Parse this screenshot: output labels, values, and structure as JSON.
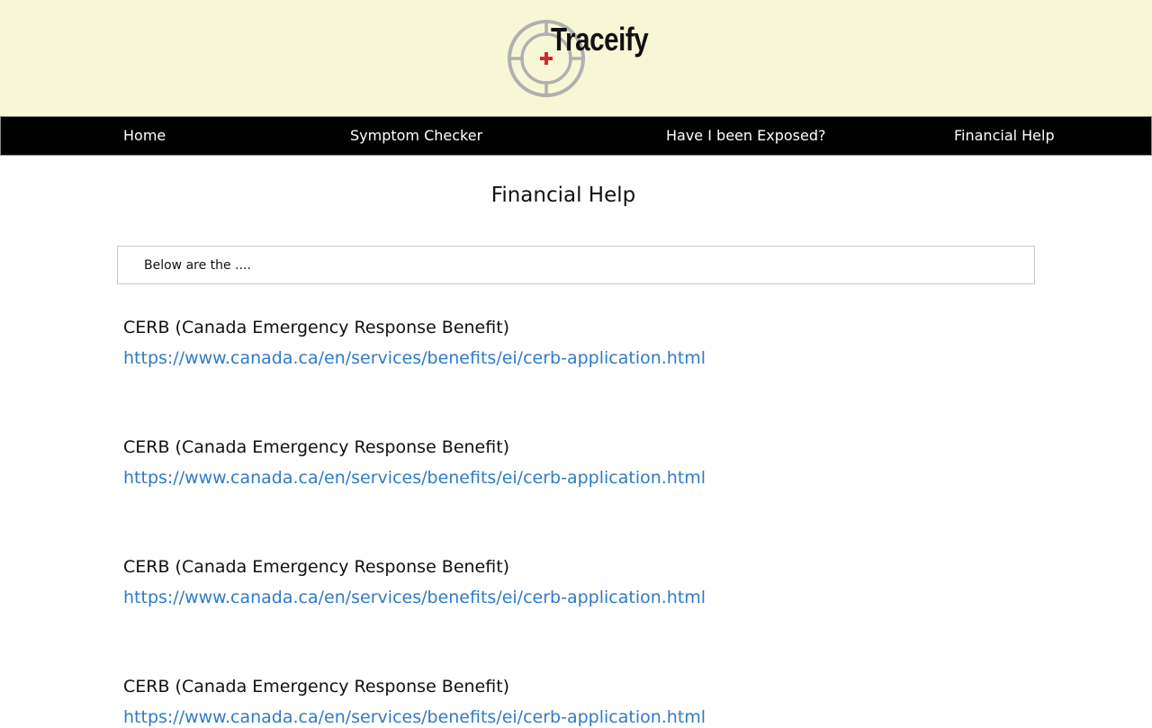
{
  "brand": {
    "name": "Traceify",
    "colors": {
      "header_bg": "#f7f7d6",
      "nav_bg": "#000000",
      "cross": "#d0282c",
      "link": "#2f7bc7"
    }
  },
  "nav": {
    "items": [
      {
        "label": "Home"
      },
      {
        "label": "Symptom Checker"
      },
      {
        "label": "Have I been Exposed?"
      },
      {
        "label": "Financial Help"
      }
    ]
  },
  "main": {
    "title": "Financial Help",
    "intro": "Below are the ....",
    "benefits": [
      {
        "title": "CERB (Canada Emergency Response Benefit)",
        "url": "https://www.canada.ca/en/services/benefits/ei/cerb-application.html"
      },
      {
        "title": "CERB (Canada Emergency Response Benefit)",
        "url": "https://www.canada.ca/en/services/benefits/ei/cerb-application.html"
      },
      {
        "title": "CERB (Canada Emergency Response Benefit)",
        "url": "https://www.canada.ca/en/services/benefits/ei/cerb-application.html"
      },
      {
        "title": "CERB (Canada Emergency Response Benefit)",
        "url": "https://www.canada.ca/en/services/benefits/ei/cerb-application.html"
      }
    ]
  }
}
